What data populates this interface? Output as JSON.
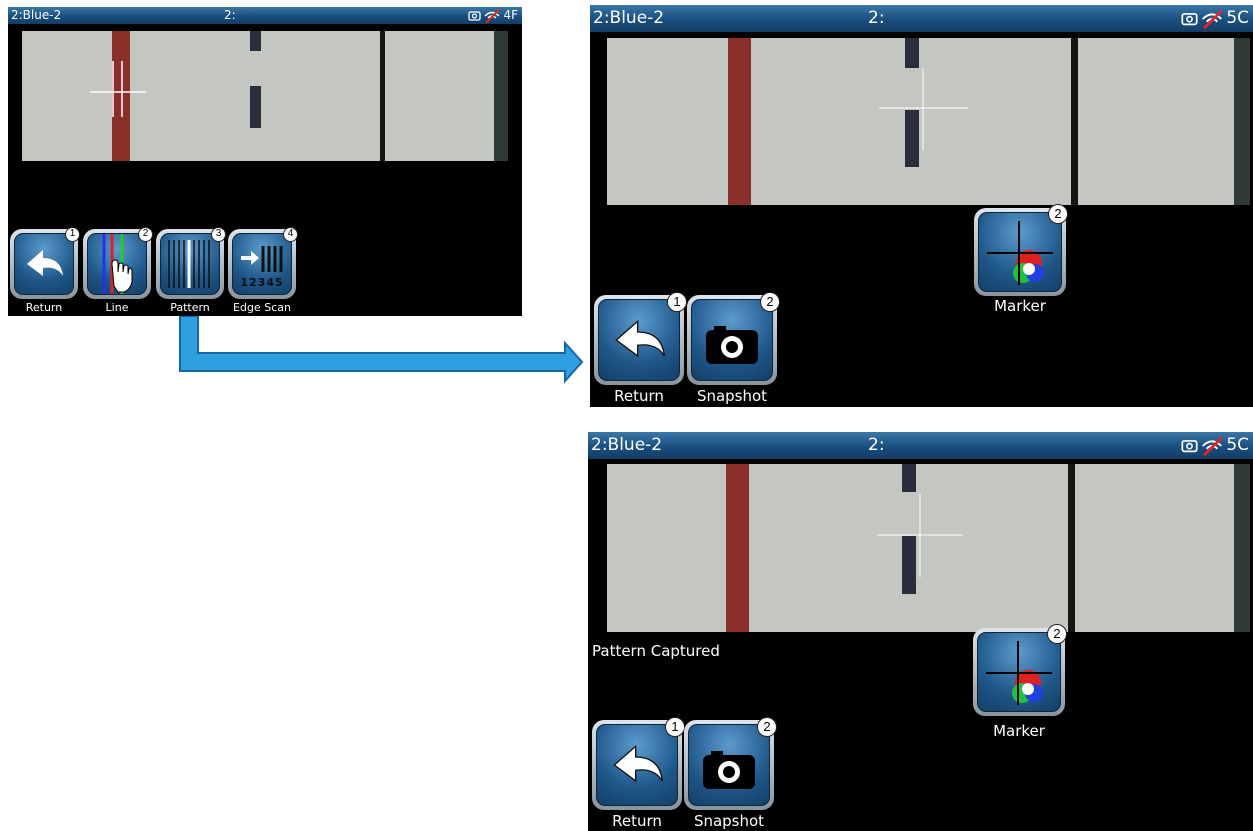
{
  "screen1": {
    "title_left": "2:Blue-2",
    "title_center": "2:",
    "status_value": "4F",
    "buttons": [
      {
        "label": "Return",
        "badge": "1"
      },
      {
        "label": "Line",
        "badge": "2"
      },
      {
        "label": "Pattern",
        "badge": "3"
      },
      {
        "label": "Edge Scan",
        "badge": "4",
        "icon_digits": "12345"
      }
    ]
  },
  "screen2": {
    "title_left": "2:Blue-2",
    "title_center": "2:",
    "status_value": "5C",
    "buttons": [
      {
        "label": "Return",
        "badge": "1"
      },
      {
        "label": "Snapshot",
        "badge": "2"
      }
    ],
    "marker": {
      "label": "Marker",
      "badge": "2"
    }
  },
  "screen3": {
    "title_left": "2:Blue-2",
    "title_center": "2:",
    "status_value": "5C",
    "status_message": "Pattern Captured",
    "buttons": [
      {
        "label": "Return",
        "badge": "1"
      },
      {
        "label": "Snapshot",
        "badge": "2"
      }
    ],
    "marker": {
      "label": "Marker",
      "badge": "2"
    }
  },
  "icons": [
    "camera-icon",
    "wifi-off-icon",
    "return-arrow-icon",
    "hand-line-icon",
    "pattern-lines-icon",
    "edge-scan-icon",
    "snapshot-camera-icon",
    "marker-color-wheel-icon"
  ],
  "colors": {
    "title_bar": "#1a4e7e",
    "button_blue": "#1f5789",
    "arrow_blue": "#2f9fe0",
    "red_line": "#8a2f2a",
    "screen_bg": "#000000"
  }
}
